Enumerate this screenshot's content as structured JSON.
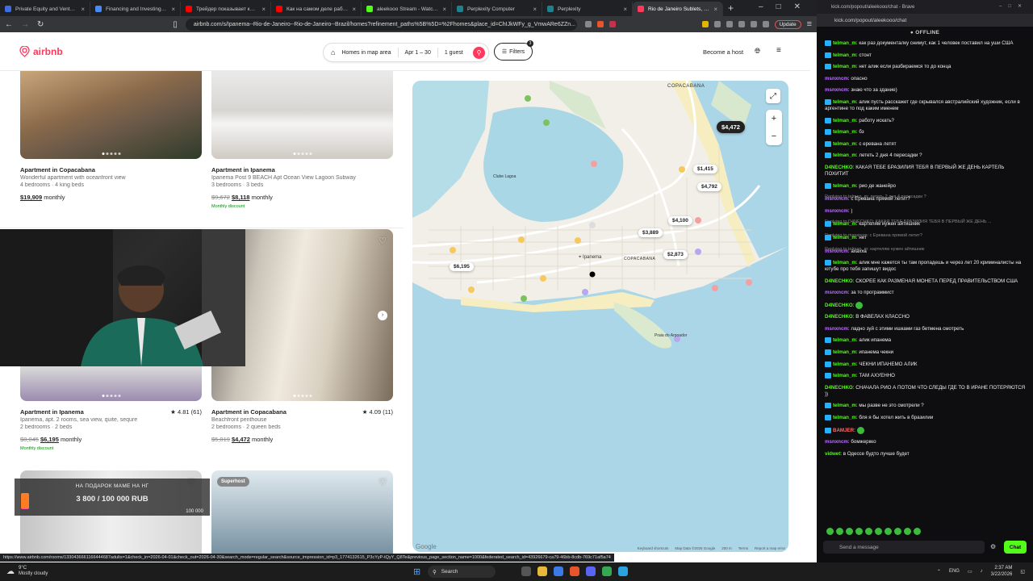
{
  "browser": {
    "tabs": [
      {
        "title": "Private Equity and Venture Capi...",
        "color": "#3d6ee3"
      },
      {
        "title": "Financing and Investing in Infra...",
        "color": "#4a8af4"
      },
      {
        "title": "Трейдер показывает как торгов...",
        "color": "#ff0000"
      },
      {
        "title": "Как на самом деле работает И...",
        "color": "#ff0000"
      },
      {
        "title": "aleekooo Stream - Watch Live o...",
        "color": "#53fc18"
      },
      {
        "title": "Perplexity Computer",
        "color": "#20808d"
      },
      {
        "title": "Perplexity",
        "color": "#20808d"
      },
      {
        "title": "Rio de Janeiro Sublets, Short...",
        "color": "#ff385c",
        "active": true
      }
    ],
    "url": "airbnb.com/s/Ipanema--Rio-de-Janeiro--Rio-de-Janeiro--Brazil/homes?refinement_paths%5B%5D=%2Fhomes&place_id=ChIJkWFy_g_VmwARe6ZZn...",
    "update_label": "Update",
    "status_url": "https://www.airbnb.com/rooms/1330436661166444687adults=1&check_in=2026-04-01&check_out=2026-04-30&search_mode=regular_search&source_impression_id=p3_1774132615_P3cYyP-tQyY_Q8Te&previous_page_section_name=1000&federated_search_id=43926679-ca79-46bb-8cdb-769c71af5a74"
  },
  "airbnb": {
    "brand": "airbnb",
    "search": {
      "location": "Homes in map area",
      "dates": "Apr 1 – 30",
      "guests": "1 guest"
    },
    "filters_label": "Filters",
    "filters_count": "3",
    "host_label": "Become a host",
    "listings": [
      {
        "title": "Apartment in Copacabana",
        "desc": "Wonderful apartment with oceanfront view",
        "rooms": "4 bedrooms · 4 king beds",
        "old_price": "",
        "price": "$19,909",
        "period": "monthly",
        "discount": "",
        "rating": ""
      },
      {
        "title": "Apartment in Ipanema",
        "desc": "Ipanema Post 9 BEACH Apt Ocean View Lagoon Subway",
        "rooms": "3 bedrooms · 3 beds",
        "old_price": "$9,672",
        "price": "$8,118",
        "period": "monthly",
        "discount": "Monthly discount",
        "rating": ""
      },
      {
        "title": "Apartment in Ipanema",
        "desc": "Ipanema, apt. 2 rooms, sea view, quite, sequre",
        "rooms": "2 bedrooms · 2 beds",
        "old_price": "$8,045",
        "price": "$6,195",
        "period": "monthly",
        "discount": "Monthly discount",
        "rating": "★ 4.81 (61)"
      },
      {
        "title": "Apartment in Copacabana",
        "desc": "Beachfront penthouse",
        "rooms": "2 bedrooms · 2 queen beds",
        "old_price": "$5,019",
        "price": "$4,472",
        "period": "monthly",
        "discount": "",
        "rating": "★ 4.09 (11)"
      }
    ],
    "superhost_label": "Superhost",
    "map": {
      "prices": [
        "$4,472",
        "$1,415",
        "$4,792",
        "$4,100",
        "$3,889",
        "$2,873",
        "$6,195"
      ],
      "area_labels": {
        "copacabana_top": "COPACABANA",
        "copacabana": "COPACABANA",
        "ipanema": "Ipanema",
        "lagoa": "Clube Lagoa",
        "praia": "Praia do Arpoador"
      },
      "footer": [
        "Keyboard shortcuts",
        "Map Data ©2026 Google",
        "200 m",
        "Terms",
        "Report a map error"
      ],
      "google": "Google"
    }
  },
  "donation": {
    "title": "НА ПОДАРОК МАМЕ НА НГ",
    "progress": "3 800 / 100 000 RUB",
    "goal_label": "100 000",
    "fraction": 0.038
  },
  "chat": {
    "window_title": "kick.com/popout/aleekooo/chat - Brave",
    "url": "kick.com/popout/aleekooo/chat",
    "status": "OFFLINE",
    "messages": [
      {
        "user": "telman_m",
        "color": "#53fc18",
        "badge": true,
        "text": "как раз документалку снимут, как 1 человек поставил на уши США",
        "reply": ""
      },
      {
        "user": "telman_m",
        "color": "#53fc18",
        "badge": true,
        "text": "стонт",
        "reply": ""
      },
      {
        "user": "telman_m",
        "color": "#53fc18",
        "badge": true,
        "text": "нет алик если разбираемся то до конца",
        "reply": ""
      },
      {
        "user": "msnxncm",
        "color": "#bc72ff",
        "badge": false,
        "text": "опасно",
        "reply": ""
      },
      {
        "user": "msnxncm",
        "color": "#bc72ff",
        "badge": false,
        "text": "знаю что за здание)",
        "reply": ""
      },
      {
        "user": "telman_m",
        "color": "#53fc18",
        "badge": true,
        "text": "алик пусть расскажет где скрывался австралийский художник, если в аргентине то под каким именем",
        "reply": ""
      },
      {
        "user": "telman_m",
        "color": "#53fc18",
        "badge": true,
        "text": "работу искать?",
        "reply": ""
      },
      {
        "user": "telman_m",
        "color": "#53fc18",
        "badge": true,
        "text": "бз",
        "reply": ""
      },
      {
        "user": "telman_m",
        "color": "#53fc18",
        "badge": true,
        "text": "с еревана летят",
        "reply": ""
      },
      {
        "user": "telman_m",
        "color": "#53fc18",
        "badge": true,
        "text": "лететь 2 дня 4 пересадки ?",
        "reply": ""
      },
      {
        "user": "D4NECHKO",
        "color": "#53fc18",
        "badge": false,
        "text": "КАКАЯ ТЕБЕ БРАЗИЛИЯ ТЕБЯ В ПЕРВЫЙ ЖЕ ДЕНЬ КАРТЕЛЬ ПОХИТИТ",
        "reply": ""
      },
      {
        "user": "telman_m",
        "color": "#53fc18",
        "badge": true,
        "text": "рио де жанейро",
        "reply": ""
      },
      {
        "user": "msnxncm",
        "color": "#bc72ff",
        "badge": false,
        "text": "с Еревана прямой летит?",
        "reply": "Replying to telman_m: лететь 2 дня 4 пересадки ?"
      },
      {
        "user": "msnxncm",
        "color": "#bc72ff",
        "badge": false,
        "text": ")",
        "reply": ""
      },
      {
        "user": "telman_m",
        "color": "#53fc18",
        "badge": true,
        "text": "картелям нужен айтишник",
        "reply": "Replying to D4NECHKO: КАКАЯ ТЕБЕ БРАЗИЛИЯ ТЕБЯ В ПЕРВЫЙ ЖЕ ДЕНЬ ..."
      },
      {
        "user": "telman_m",
        "color": "#53fc18",
        "badge": true,
        "text": "нет",
        "reply": "Replying to msnxncm: с Еревана прямой летит?"
      },
      {
        "user": "msnxncm",
        "color": "#bc72ff",
        "badge": false,
        "text": "ахахха",
        "reply": "Replying to telman_m: картелям нужен айтишник"
      },
      {
        "user": "telman_m",
        "color": "#53fc18",
        "badge": true,
        "text": "алик мне кажется ты там пропадешь и через лет 20 криминалисты на ютубе про тебя запишут видос",
        "reply": ""
      },
      {
        "user": "D4NECHKO",
        "color": "#53fc18",
        "badge": false,
        "text": "СКОРЕЕ КАК РАЗМЕНАЯ МОНЕТА ПЕРЕД ПРАВИТЕЛЬСТВОМ США",
        "reply": ""
      },
      {
        "user": "msnxncm",
        "color": "#bc72ff",
        "badge": false,
        "text": "за то программист",
        "reply": ""
      },
      {
        "user": "D4NECHKO",
        "color": "#53fc18",
        "badge": false,
        "text": "",
        "reply": ""
      },
      {
        "user": "D4NECHKO",
        "color": "#53fc18",
        "badge": false,
        "text": "В ФАВЕЛАХ КЛАССНО",
        "reply": ""
      },
      {
        "user": "msnxncm",
        "color": "#bc72ff",
        "badge": false,
        "text": "ладно зуй с этими ишками газ бетмена смотреть",
        "reply": ""
      },
      {
        "user": "telman_m",
        "color": "#53fc18",
        "badge": true,
        "text": "алик ипанема",
        "reply": ""
      },
      {
        "user": "telman_m",
        "color": "#53fc18",
        "badge": true,
        "text": "ипанема чекни",
        "reply": ""
      },
      {
        "user": "telman_m",
        "color": "#53fc18",
        "badge": true,
        "text": "ЧЕКНИ ИПАНЕМО АЛИК",
        "reply": ""
      },
      {
        "user": "telman_m",
        "color": "#53fc18",
        "badge": true,
        "text": "ТАМ АХУЕННО",
        "reply": ""
      },
      {
        "user": "D4NECHKO",
        "color": "#53fc18",
        "badge": false,
        "text": "СНАЧАЛА РИО А ПОТОМ ЧТО СЛЕДЫ ГДЕ ТО В ИРАНЕ ПОТЕРЯЮТСЯ ))",
        "reply": ""
      },
      {
        "user": "telman_m",
        "color": "#53fc18",
        "badge": true,
        "text": "мы разве не это смотрели ?",
        "reply": ""
      },
      {
        "user": "telman_m",
        "color": "#53fc18",
        "badge": true,
        "text": "бля я бы хотел жить в бразилии",
        "reply": ""
      },
      {
        "user": "BAMJER",
        "color": "#ff6b6b",
        "badge": true,
        "text": "",
        "reply": ""
      },
      {
        "user": "msnxncm",
        "color": "#bc72ff",
        "badge": false,
        "text": "бомжеркко",
        "reply": ""
      },
      {
        "user": "vidwet",
        "color": "#53fc18",
        "badge": false,
        "text": "в Одессе будто лучше будет",
        "reply": ""
      }
    ],
    "input_placeholder": "Send a message",
    "send_label": "Chat"
  },
  "taskbar": {
    "temperature": "9°C",
    "weather": "Mostly cloudy",
    "search_label": "Search",
    "language": "ENG",
    "time": "2:37 AM",
    "date": "3/22/2026"
  }
}
